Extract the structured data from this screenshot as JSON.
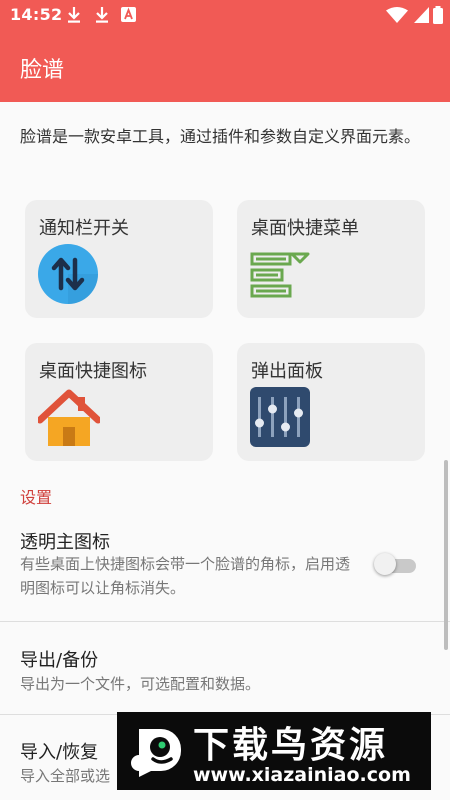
{
  "status_bar": {
    "time": "14:52",
    "icons": [
      "download-icon",
      "download-icon",
      "font-a-icon",
      "wifi-icon",
      "battery-icon"
    ]
  },
  "app_bar": {
    "title": "脸谱"
  },
  "intro": {
    "text": "脸谱是一款安卓工具，通过插件和参数自定义界面元素。"
  },
  "cards": [
    {
      "label": "通知栏开关",
      "icon": "notification-toggle-icon"
    },
    {
      "label": "桌面快捷菜单",
      "icon": "menu-list-icon"
    },
    {
      "label": "桌面快捷图标",
      "icon": "house-icon"
    },
    {
      "label": "弹出面板",
      "icon": "sliders-icon"
    }
  ],
  "settings": {
    "section_title": "设置",
    "items": [
      {
        "title": "透明主图标",
        "desc": "有些桌面上快捷图标会带一个脸谱的角标，启用透明图标可以让角标消失。",
        "toggle_on": false
      },
      {
        "title": "导出/备份",
        "desc": "导出为一个文件，可选配置和数据。"
      },
      {
        "title": "导入/恢复",
        "desc": "导入全部或选"
      }
    ]
  },
  "watermark": {
    "brand": "下载鸟资源",
    "url": "www.xiazainiao.com"
  },
  "colors": {
    "primary": "#f15a55",
    "section": "#d0403c",
    "card_bg": "#eeeeee",
    "icon_blue": "#3aa8e8",
    "icon_green": "#6aa84f",
    "icon_orange": "#f09a2a",
    "icon_navy": "#2f4a6e"
  }
}
